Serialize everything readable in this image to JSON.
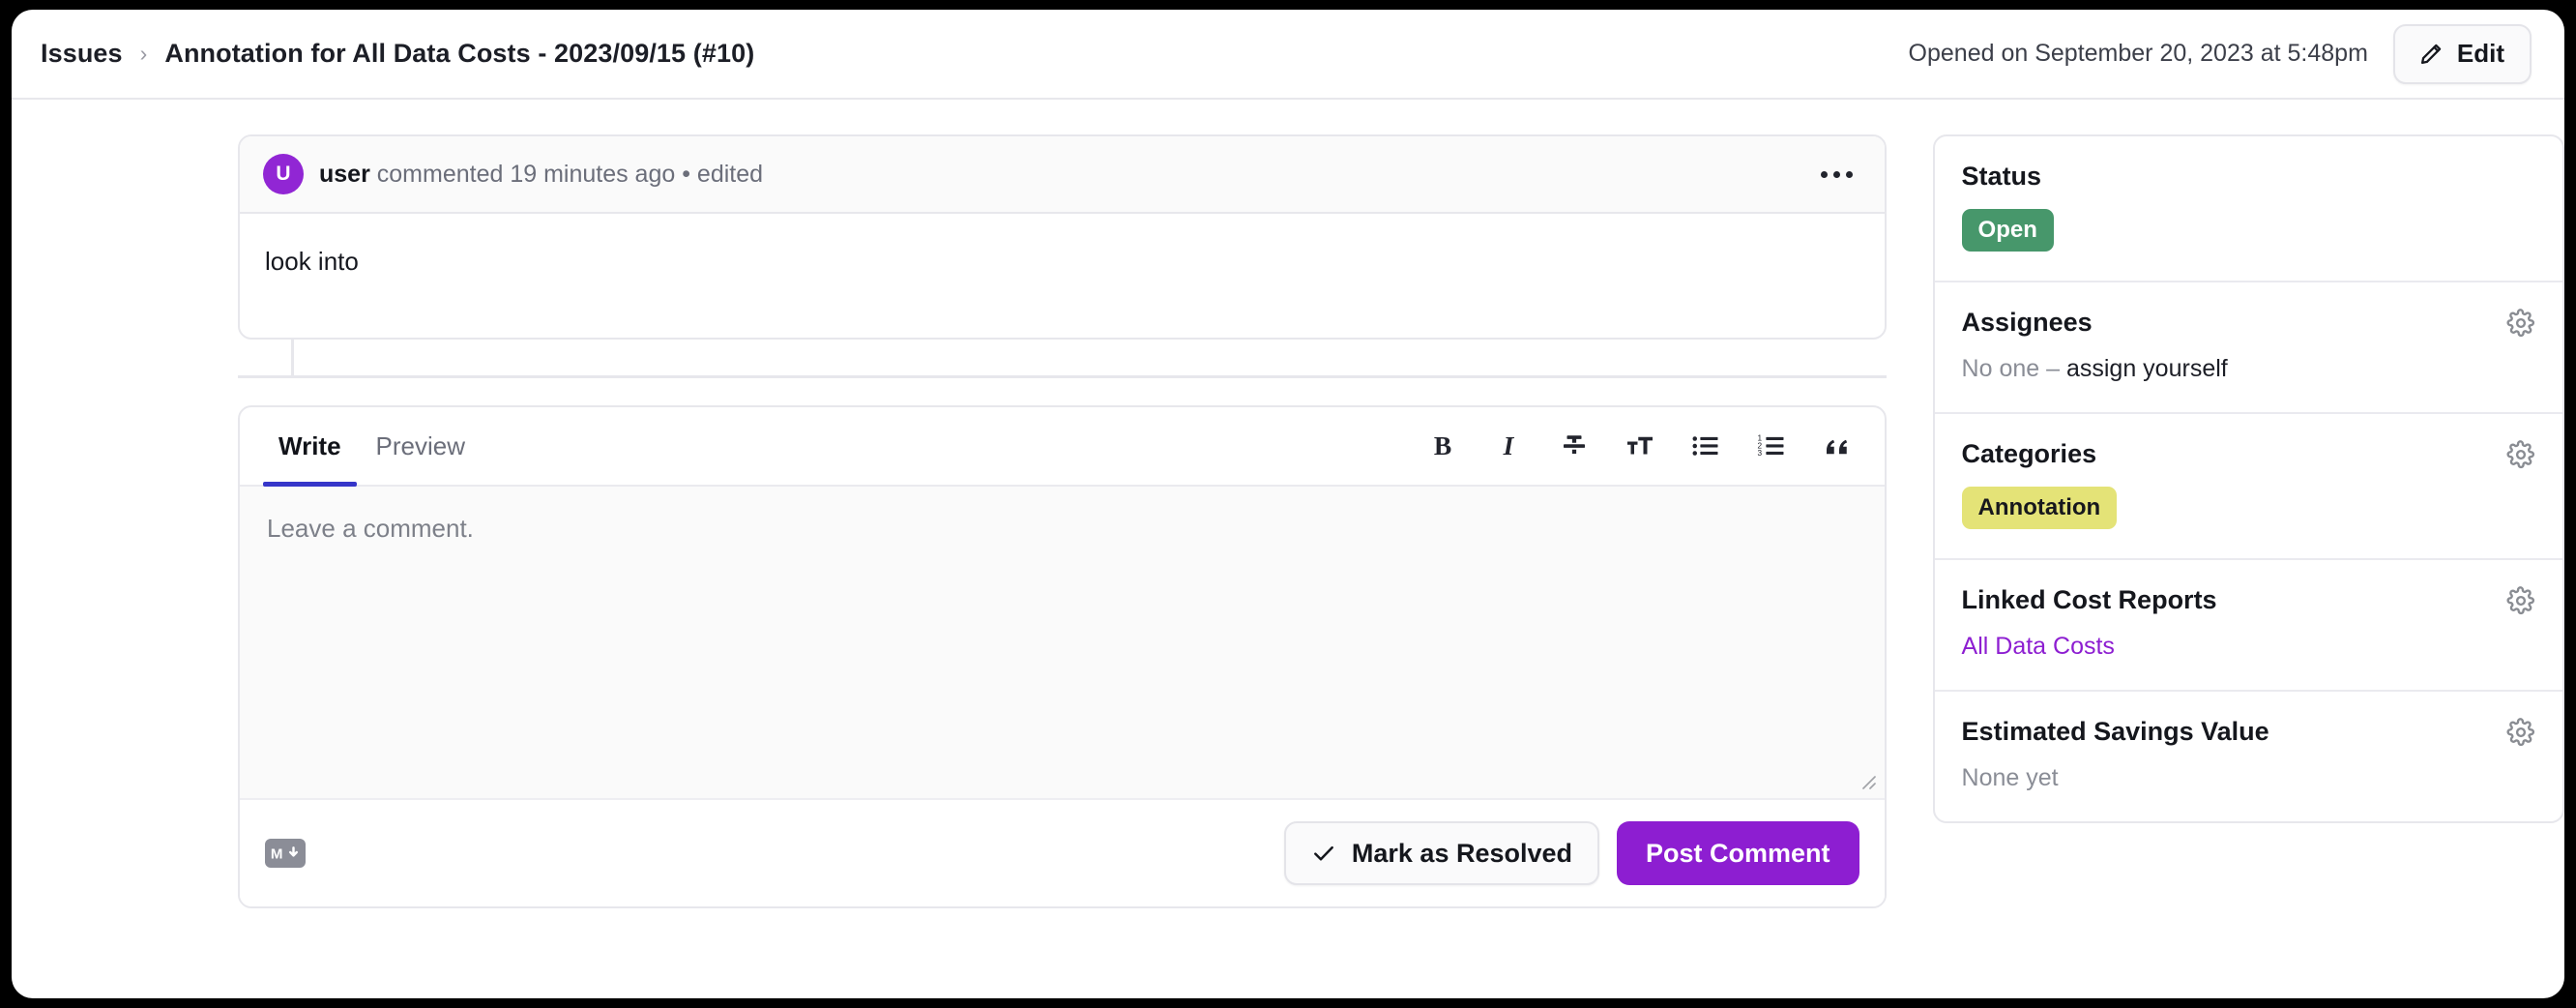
{
  "window": {
    "breadcrumb_root": "Issues",
    "breadcrumb_separator": "›",
    "breadcrumb_current": "Annotation for All Data Costs - 2023/09/15 (#10)",
    "opened_on": "Opened on September 20, 2023 at 5:48pm",
    "edit_label": "Edit"
  },
  "comment": {
    "avatar_initial": "U",
    "author": "user",
    "meta": " commented 19 minutes ago • edited",
    "body": "look into",
    "menu_label": "..."
  },
  "editor": {
    "tabs": [
      {
        "label": "Write",
        "active": true
      },
      {
        "label": "Preview",
        "active": false
      }
    ],
    "toolbar": [
      {
        "name": "bold-icon",
        "label": "B"
      },
      {
        "name": "italic-icon",
        "label": "I"
      },
      {
        "name": "strikethrough-icon",
        "label": "S"
      },
      {
        "name": "heading-icon",
        "label": "tT"
      },
      {
        "name": "bulleted-list-icon",
        "label": "• list"
      },
      {
        "name": "numbered-list-icon",
        "label": "1. list"
      },
      {
        "name": "quote-icon",
        "label": "”"
      }
    ],
    "placeholder": "Leave a comment.",
    "value": "",
    "markdown_badge": "M↓",
    "resolve_label": "Mark as Resolved",
    "post_label": "Post Comment"
  },
  "sidebar": {
    "sections": [
      {
        "title": "Status",
        "badge": "Open",
        "has_gear": false
      },
      {
        "title": "Assignees",
        "value_muted": "No one – ",
        "value_link": "assign yourself",
        "has_gear": true
      },
      {
        "title": "Categories",
        "chip": "Annotation",
        "has_gear": true
      },
      {
        "title": "Linked Cost Reports",
        "link": "All Data Costs",
        "has_gear": true
      },
      {
        "title": "Estimated Savings Value",
        "value": "None yet",
        "has_gear": true
      }
    ]
  },
  "colors": {
    "accent_purple": "#8d1ed1",
    "status_green": "#47976b",
    "category_yellow": "#e4e377",
    "tab_active_underline": "#3636c9",
    "avatar_purple": "#9126d4"
  }
}
